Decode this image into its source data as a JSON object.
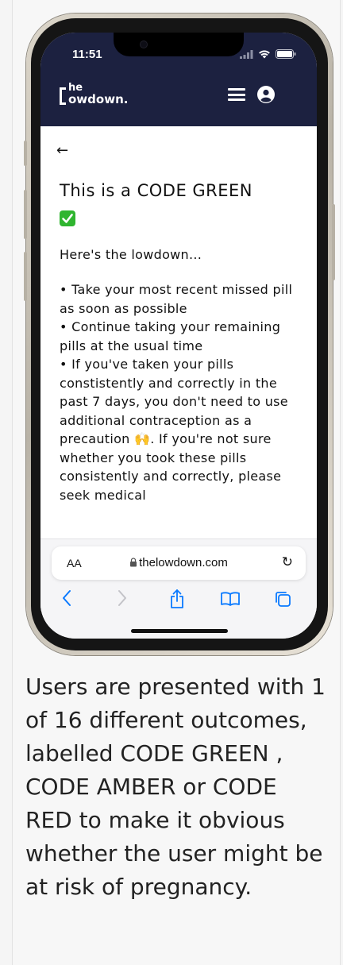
{
  "status_bar": {
    "time": "11:51"
  },
  "header": {
    "logo_top": "he",
    "logo_bottom": "owdown.",
    "bg_color": "#1c2140"
  },
  "page": {
    "back_symbol": "←",
    "title": "This is a CODE GREEN",
    "title_emoji": "check-mark-icon",
    "intro": "Here's the lowdown...",
    "bullets": [
      "• Take your most recent missed pill as soon as possible",
      "• Continue taking your remaining pills at the usual time",
      "• If you've taken your pills constistently and correctly in the past 7 days, you don't need to use additional contraception as a precaution 🙌. If you're not sure whether you took these pills consistently and correctly, please seek medical"
    ]
  },
  "browser": {
    "aa_label": "AA",
    "url": "thelowdown.com",
    "toolbar_icons": [
      "back-icon",
      "forward-icon",
      "share-icon",
      "bookmarks-icon",
      "tabs-icon"
    ]
  },
  "caption": "Users are presented with 1 of 16 different outcomes, labelled CODE GREEN , CODE AMBER or CODE RED to make it obvious whether the user might be at risk of pregnancy.",
  "colors": {
    "accent_blue": "#0a7aff",
    "check_green": "#2fb52f"
  }
}
